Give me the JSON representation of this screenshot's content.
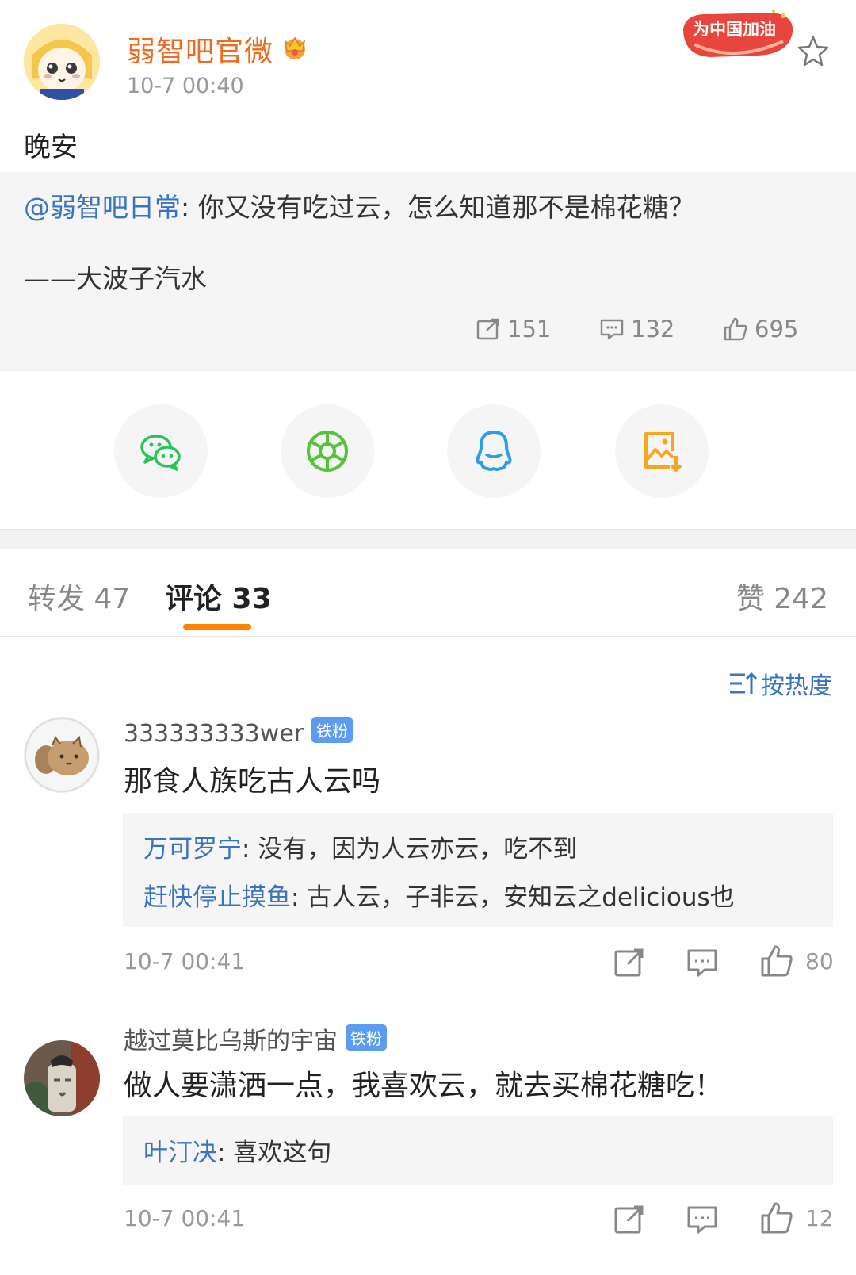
{
  "post": {
    "author": "弱智吧官微",
    "time": "10-7 00:40",
    "text": "晚安",
    "cheer_badge": "为中国加油"
  },
  "repost": {
    "user": "@弱智吧日常",
    "text": ": 你又没有吃过云，怎么知道那不是棉花糖？",
    "signature": "——大波子汽水",
    "shares": "151",
    "comments": "132",
    "likes": "695"
  },
  "share_targets": [
    {
      "icon": "wechat-icon",
      "color": "#2bc25a"
    },
    {
      "icon": "moments-icon",
      "color": "#56c23c"
    },
    {
      "icon": "qq-icon",
      "color": "#2f9de6"
    },
    {
      "icon": "save-image-icon",
      "color": "#f5a623"
    }
  ],
  "tabs": {
    "repost": "转发 47",
    "comment": "评论 33",
    "like": "赞 242",
    "active": "comment",
    "accent": "#ff8200"
  },
  "sort": {
    "label": "按热度"
  },
  "comments": [
    {
      "name": "333333333wer",
      "badge": "铁粉",
      "text": "那食人族吃古人云吗",
      "replies": [
        {
          "user": "万可罗宁",
          "text": ": 没有，因为人云亦云，吃不到"
        },
        {
          "user": "赶快停止摸鱼",
          "text": ": 古人云，子非云，安知云之delicious也"
        }
      ],
      "time": "10-7 00:41",
      "likes": "80"
    },
    {
      "name": "越过莫比乌斯的宇宙",
      "badge": "铁粉",
      "text": "做人要潇洒一点，我喜欢云，就去买棉花糖吃！",
      "replies": [
        {
          "user": "叶汀决",
          "text": ": 喜欢这句"
        }
      ],
      "time": "10-7 00:41",
      "likes": "12"
    }
  ],
  "colors": {
    "author": "#f06a1f",
    "link": "#3a74c0",
    "badge": "#5b9cf0"
  }
}
